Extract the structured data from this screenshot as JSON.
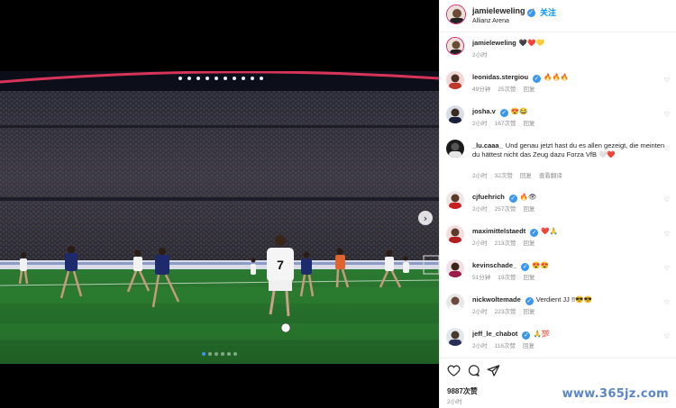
{
  "post": {
    "username": "jamieleweling",
    "follow_sep": "•",
    "follow_label": "关注",
    "location": "Allianz Arena",
    "likes": "9887次赞",
    "time_ago": "2小时"
  },
  "carousel": {
    "next_glyph": "›",
    "dot_count": 6,
    "active_dot": 0,
    "jersey_number": "7"
  },
  "comments": [
    {
      "username": "jamieleweling",
      "verified": false,
      "text": "🖤❤️💛",
      "time": "2小时",
      "likes": "",
      "reply": ""
    },
    {
      "username": "leonidas.stergiou",
      "verified": true,
      "text": "🔥🔥🔥",
      "time": "49分钟",
      "likes": "25次赞",
      "reply": "回复"
    },
    {
      "username": "josha.v",
      "verified": true,
      "text": "😍😂",
      "time": "2小时",
      "likes": "167次赞",
      "reply": "回复"
    },
    {
      "username": "_lu.caaa_",
      "verified": false,
      "text": "Und genau jetzt hast du es allen gezeigt, die meinten du hättest nicht das Zeug dazu Forza VfB 🤍❤️",
      "time": "2小时",
      "likes": "32次赞",
      "reply": "回复",
      "translate": "查看翻译"
    },
    {
      "username": "cjfuehrich",
      "verified": true,
      "text": "🔥👁",
      "time": "2小时",
      "likes": "257次赞",
      "reply": "回复"
    },
    {
      "username": "maximittelstaedt",
      "verified": true,
      "text": "❤️🙏",
      "time": "2小时",
      "likes": "213次赞",
      "reply": "回复"
    },
    {
      "username": "kevinschade_",
      "verified": true,
      "text": "😍😍",
      "time": "51分钟",
      "likes": "19次赞",
      "reply": "回复"
    },
    {
      "username": "nickwoltemade",
      "verified": true,
      "text": "Verdient JJ !!😎😎",
      "time": "2小时",
      "likes": "223次赞",
      "reply": "回复"
    },
    {
      "username": "jeff_le_chabot",
      "verified": true,
      "text": "🙏💯",
      "time": "2小时",
      "likes": "116次赞",
      "reply": "回复"
    }
  ],
  "icons": {
    "like": "heart-outline-icon",
    "comment": "speech-bubble-icon",
    "share": "paper-plane-icon"
  },
  "watermark": "www.365jz.com",
  "colors": {
    "link_blue": "#0095f6",
    "verified_blue": "#3897f0",
    "muted_gray": "#8e8e8e",
    "pitch_green": "#2f7a2f"
  }
}
